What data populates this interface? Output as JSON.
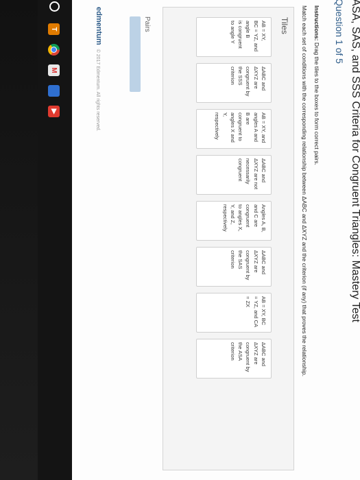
{
  "header": {
    "title": "ASA, SAS, and SSS Criteria for Congruent Triangles: Mastery Test",
    "question": "Question 1 of 5"
  },
  "instructions": {
    "lead": "Instructions:",
    "text": " Drag the tiles to the boxes to form correct pairs.",
    "subtext": "Match each set of conditions with the corresponding relationship between ΔABC and ΔXYZ and the criterion (if any) that proves the relationship."
  },
  "tiles": {
    "label": "Tiles",
    "items": [
      "AB = XY,\nBC = YZ, and\nangle B\nis congruent\nto angle Y",
      "ΔABC and\nΔXYZ are\ncongruent by\nthe SSS\ncriterion",
      "AB = XY, and\nangles A and\nB are\ncongruent to\nangles X and\nY,\nrespectively",
      "ΔABC and\nΔXYZ are not\nnecessarily\ncongruent",
      "Angles A, B,\nand C are\ncongruent\nto angles X,\nY, and Z,\nrespectively",
      "ΔABC and\nΔXYZ are\ncongruent by\nthe SAS\ncriterion",
      "AB = XY, BC\n= YZ, and CA\n= ZX",
      "ΔABC and\nΔXYZ are\ncongruent by\nthe ASA\ncriterion"
    ]
  },
  "pairs": {
    "label": "Pairs"
  },
  "footer": {
    "logo": "edmentum",
    "copyright": "© 2017 Edmentum. All rights reserved."
  },
  "taskbar": {
    "icons": [
      {
        "name": "start-icon",
        "color": "#ffffff",
        "glyph": ""
      },
      {
        "name": "tt-app-icon",
        "color": "#e07b00",
        "glyph": "T"
      },
      {
        "name": "chrome-icon",
        "color": "#3a8ad9",
        "glyph": ""
      },
      {
        "name": "gmail-icon",
        "color": "#d8d8d8",
        "glyph": ""
      },
      {
        "name": "files-icon",
        "color": "#2f6fd0",
        "glyph": ""
      },
      {
        "name": "youtube-icon",
        "color": "#e03a2f",
        "glyph": "▶"
      }
    ]
  }
}
